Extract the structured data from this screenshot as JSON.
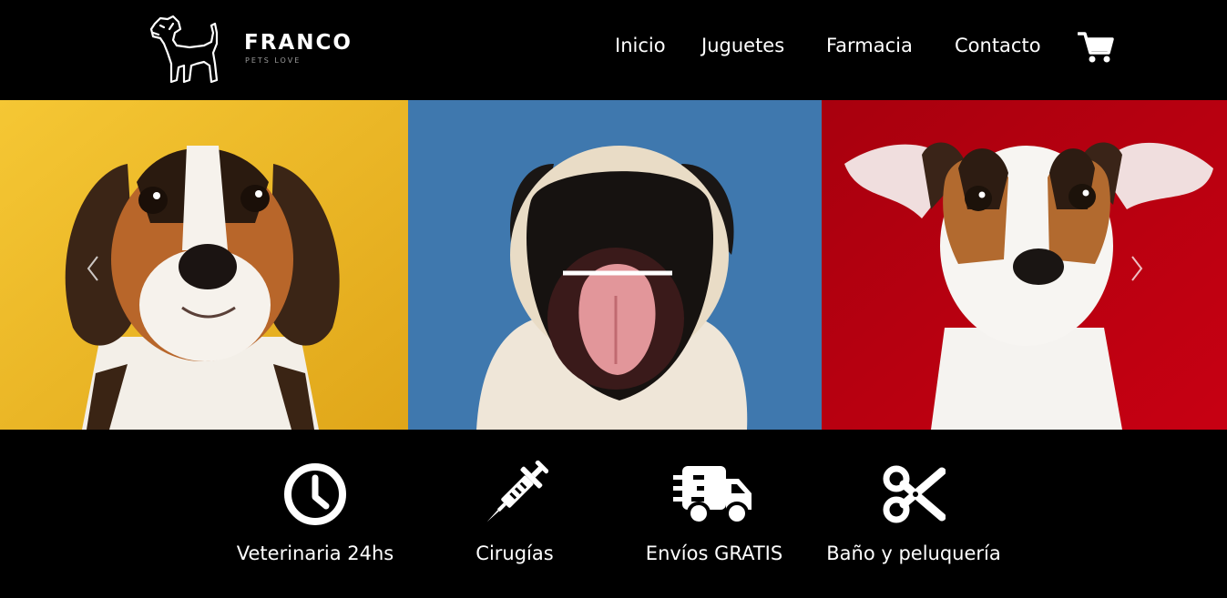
{
  "brand": {
    "name": "FRANCO",
    "tagline": "PETS LOVE",
    "logo_icon": "dog-outline-icon"
  },
  "nav": {
    "items": [
      {
        "label": "Inicio"
      },
      {
        "label": "Juguetes"
      },
      {
        "label": "Farmacia"
      },
      {
        "label": "Contacto"
      }
    ],
    "cart_icon": "shopping-cart-icon"
  },
  "carousel": {
    "slides": [
      {
        "subject": "beagle-puppy",
        "background": "#f1c12a"
      },
      {
        "subject": "pug-yawning",
        "background": "#3f79b0"
      },
      {
        "subject": "jack-russell-puppy",
        "background": "#b3000e"
      }
    ],
    "prev_icon": "chevron-left-icon",
    "next_icon": "chevron-right-icon"
  },
  "services": [
    {
      "label": "Veterinaria 24hs",
      "icon": "clock-icon"
    },
    {
      "label": "Cirugías",
      "icon": "syringe-icon"
    },
    {
      "label": "Envíos GRATIS",
      "icon": "delivery-truck-icon"
    },
    {
      "label": "Baño y peluquería",
      "icon": "scissors-icon"
    }
  ]
}
